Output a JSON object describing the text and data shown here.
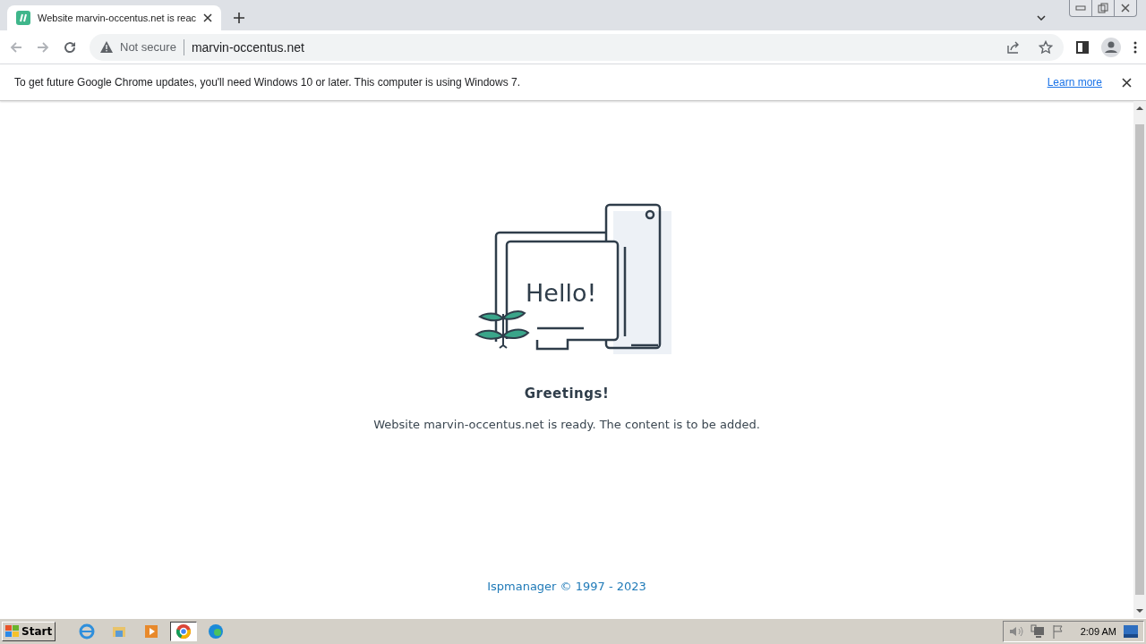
{
  "browser": {
    "tab": {
      "title": "Website marvin-occentus.net is reac"
    },
    "address": {
      "security": "Not secure",
      "url": "marvin-occentus.net"
    }
  },
  "infobar": {
    "message": "To get future Google Chrome updates, you'll need Windows 10 or later. This computer is using Windows 7.",
    "link": "Learn more"
  },
  "page": {
    "illustration_text": "Hello!",
    "heading": "Greetings!",
    "message": "Website marvin-occentus.net is ready. The content is to be added.",
    "footer": "Ispmanager © 1997 - 2023"
  },
  "taskbar": {
    "start": "Start",
    "apps": [
      {
        "kind": "ie",
        "selected": false
      },
      {
        "kind": "folder",
        "selected": false
      },
      {
        "kind": "media",
        "selected": false
      },
      {
        "kind": "chrome",
        "selected": true
      },
      {
        "kind": "edge",
        "selected": false
      }
    ],
    "clock": "2:09 AM"
  }
}
